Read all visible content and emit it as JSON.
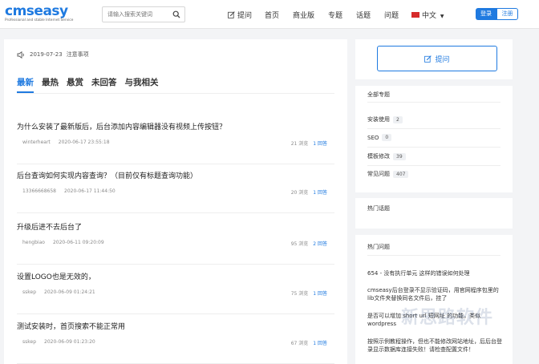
{
  "header": {
    "logo_main": "cmseasy",
    "logo_tagline": "Professional and stable Internet Service",
    "search_placeholder": "请输入搜索关键词",
    "nav": {
      "ask": "提问",
      "home": "首页",
      "commercial": "商业版",
      "topics": "专题",
      "tags": "话题",
      "questions": "问题",
      "language": "中文"
    },
    "login": "登录",
    "register": "注册"
  },
  "notice": {
    "date": "2019-07-23",
    "text": "注意事项"
  },
  "tabs": [
    "最新",
    "最热",
    "悬赏",
    "未回答",
    "与我相关"
  ],
  "questions": [
    {
      "title": "为什么安装了最新版后，后台添加内容编辑器没有视频上传按钮？",
      "user": "winterheart",
      "date": "2020-06-17 23:55:18",
      "views": "21 浏览",
      "answers": "1 回答"
    },
    {
      "title": "后台查询如何实现内容查询？（目前仅有标题查询功能）",
      "user": "13366668658",
      "date": "2020-06-17 11:44:50",
      "views": "20 浏览",
      "answers": "1 回答"
    },
    {
      "title": "升级后进不去后台了",
      "user": "hengbiao",
      "date": "2020-06-11 09:20:09",
      "views": "95 浏览",
      "answers": "2 回答"
    },
    {
      "title": "设置LOGO也是无效的，",
      "user": "sskep",
      "date": "2020-06-09 01:24:21",
      "views": "75 浏览",
      "answers": "1 回答"
    },
    {
      "title": "测试安装时，首页搜索不能正常用",
      "user": "sskep",
      "date": "2020-06-09 01:23:20",
      "views": "67 浏览",
      "answers": "1 回答"
    }
  ],
  "sidebar": {
    "ask_button": "提问",
    "all_topics_title": "全部专题",
    "topics": [
      {
        "name": "安装使用",
        "count": "2"
      },
      {
        "name": "SEO",
        "count": "0"
      },
      {
        "name": "模板修改",
        "count": "39"
      },
      {
        "name": "常见问题",
        "count": "407"
      }
    ],
    "hot_topics_title": "热门话题",
    "hot_questions_title": "热门问题",
    "hot_questions": [
      "654 - 没有执行单元 这样的错误如何处理",
      "cmseasy后台登录不显示验证码，用官网程序包里的lib文件夹替换同名文件后，挂了",
      "是否可以增加 short url 短网址 的功能，类似 wordpress",
      "按照示例教程操作，但也不能修改网站地址，后后台登录显示数据库连接失败！请检查配置文件！"
    ],
    "watermark": "新思路软件"
  }
}
